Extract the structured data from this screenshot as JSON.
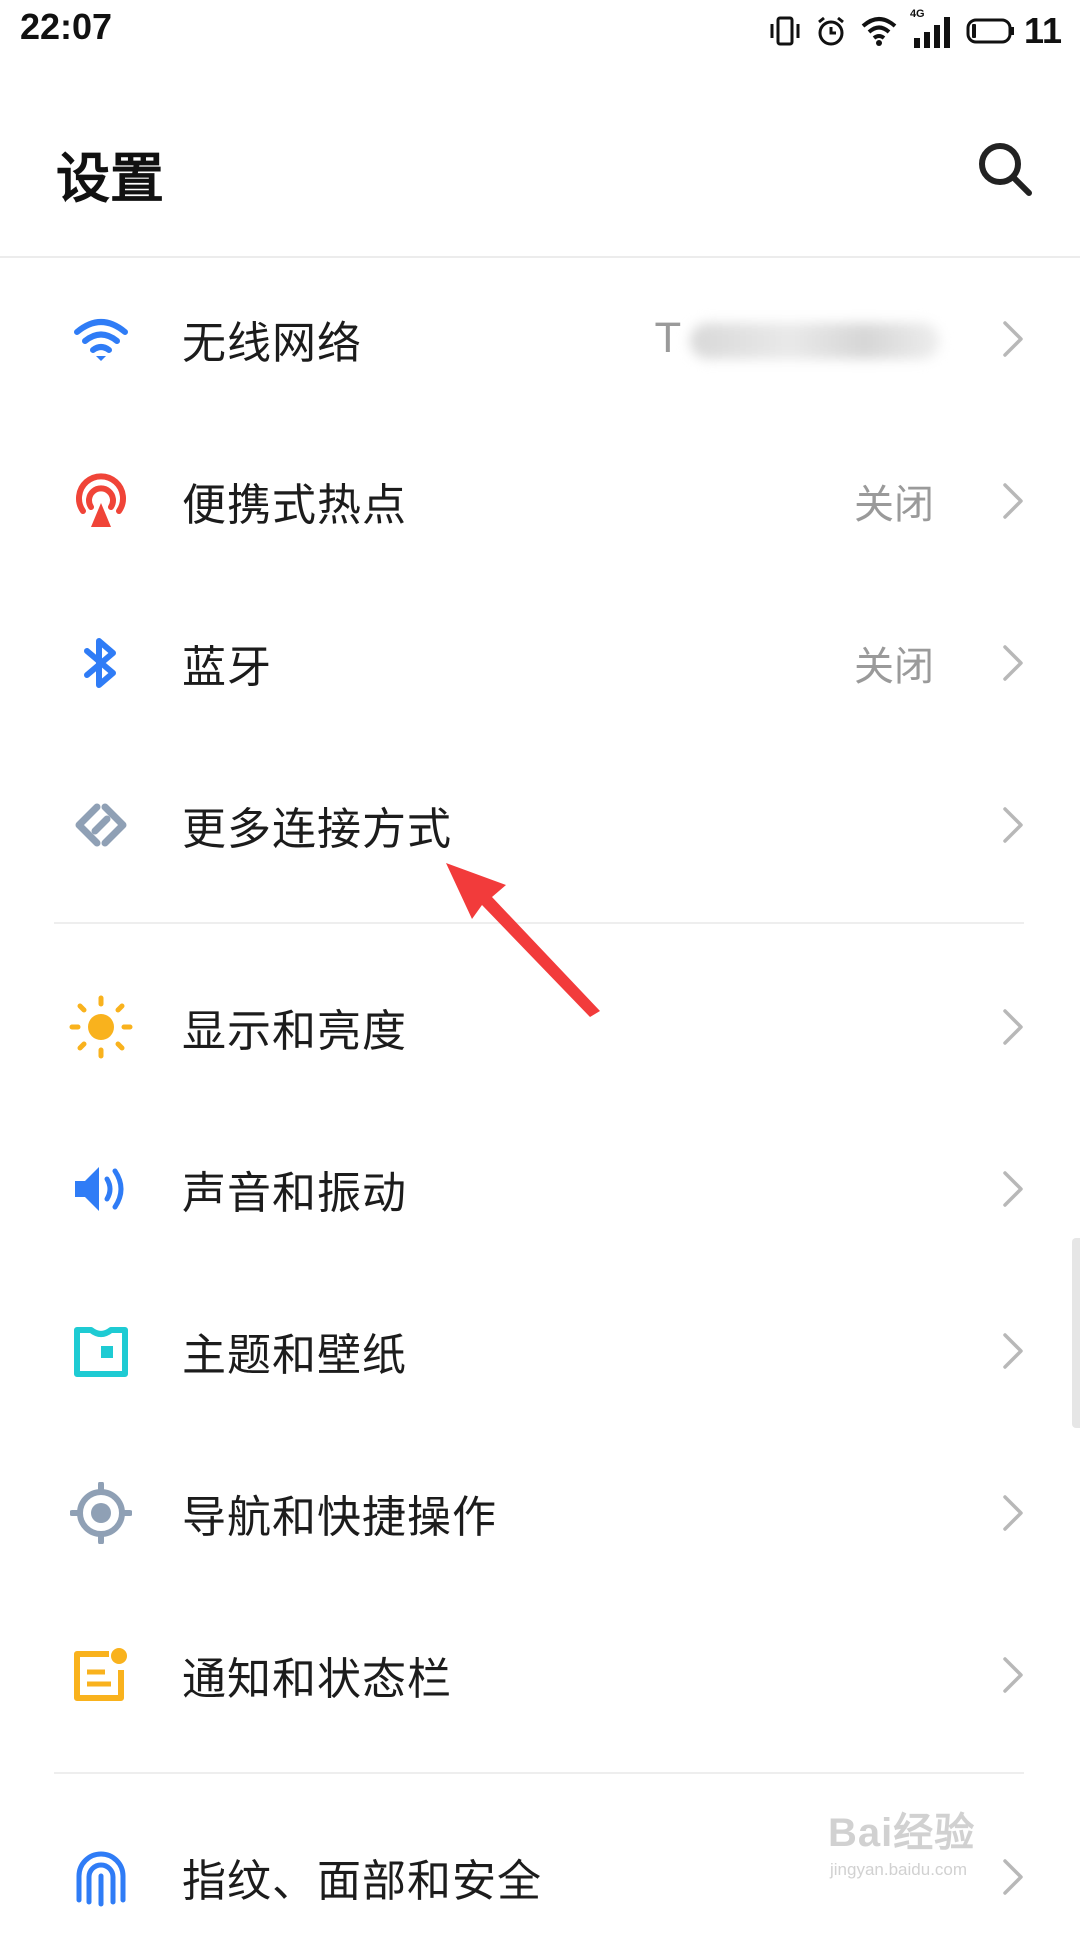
{
  "status_bar": {
    "time": "22:07",
    "network_badge": "4G",
    "battery_level": "11",
    "icons": [
      "vibrate-icon",
      "alarm-icon",
      "wifi-icon",
      "cellular-4g-icon",
      "battery-icon"
    ]
  },
  "header": {
    "title": "设置",
    "search_icon": "search-icon"
  },
  "settings": [
    {
      "id": "wifi",
      "label": "无线网络",
      "value": "T",
      "value_obscured": true,
      "icon": "wifi-icon",
      "color": "#2f7cf6"
    },
    {
      "id": "hotspot",
      "label": "便携式热点",
      "value": "关闭",
      "icon": "hotspot-icon",
      "color": "#f04438"
    },
    {
      "id": "bluetooth",
      "label": "蓝牙",
      "value": "关闭",
      "icon": "bluetooth-icon",
      "color": "#2f7cf6"
    },
    {
      "id": "more-connections",
      "label": "更多连接方式",
      "value": "",
      "icon": "link-icon",
      "color": "#8fa0b5"
    },
    {
      "id": "display",
      "label": "显示和亮度",
      "value": "",
      "icon": "sun-icon",
      "color": "#f9b21d"
    },
    {
      "id": "sound",
      "label": "声音和振动",
      "value": "",
      "icon": "speaker-icon",
      "color": "#2f7cf6"
    },
    {
      "id": "theme",
      "label": "主题和壁纸",
      "value": "",
      "icon": "theme-shirt-icon",
      "color": "#1ecbd3"
    },
    {
      "id": "navigation",
      "label": "导航和快捷操作",
      "value": "",
      "icon": "navigation-target-icon",
      "color": "#8fa0b5"
    },
    {
      "id": "notifications",
      "label": "通知和状态栏",
      "value": "",
      "icon": "notification-icon",
      "color": "#f9b21d"
    },
    {
      "id": "security",
      "label": "指纹、面部和安全",
      "value": "",
      "icon": "fingerprint-icon",
      "color": "#2f7cf6"
    }
  ],
  "annotation": {
    "type": "arrow",
    "color": "#f23b3b",
    "points_to": "更多连接方式"
  },
  "watermark": {
    "brand": "Bai经验",
    "url": "jingyan.baidu.com"
  }
}
